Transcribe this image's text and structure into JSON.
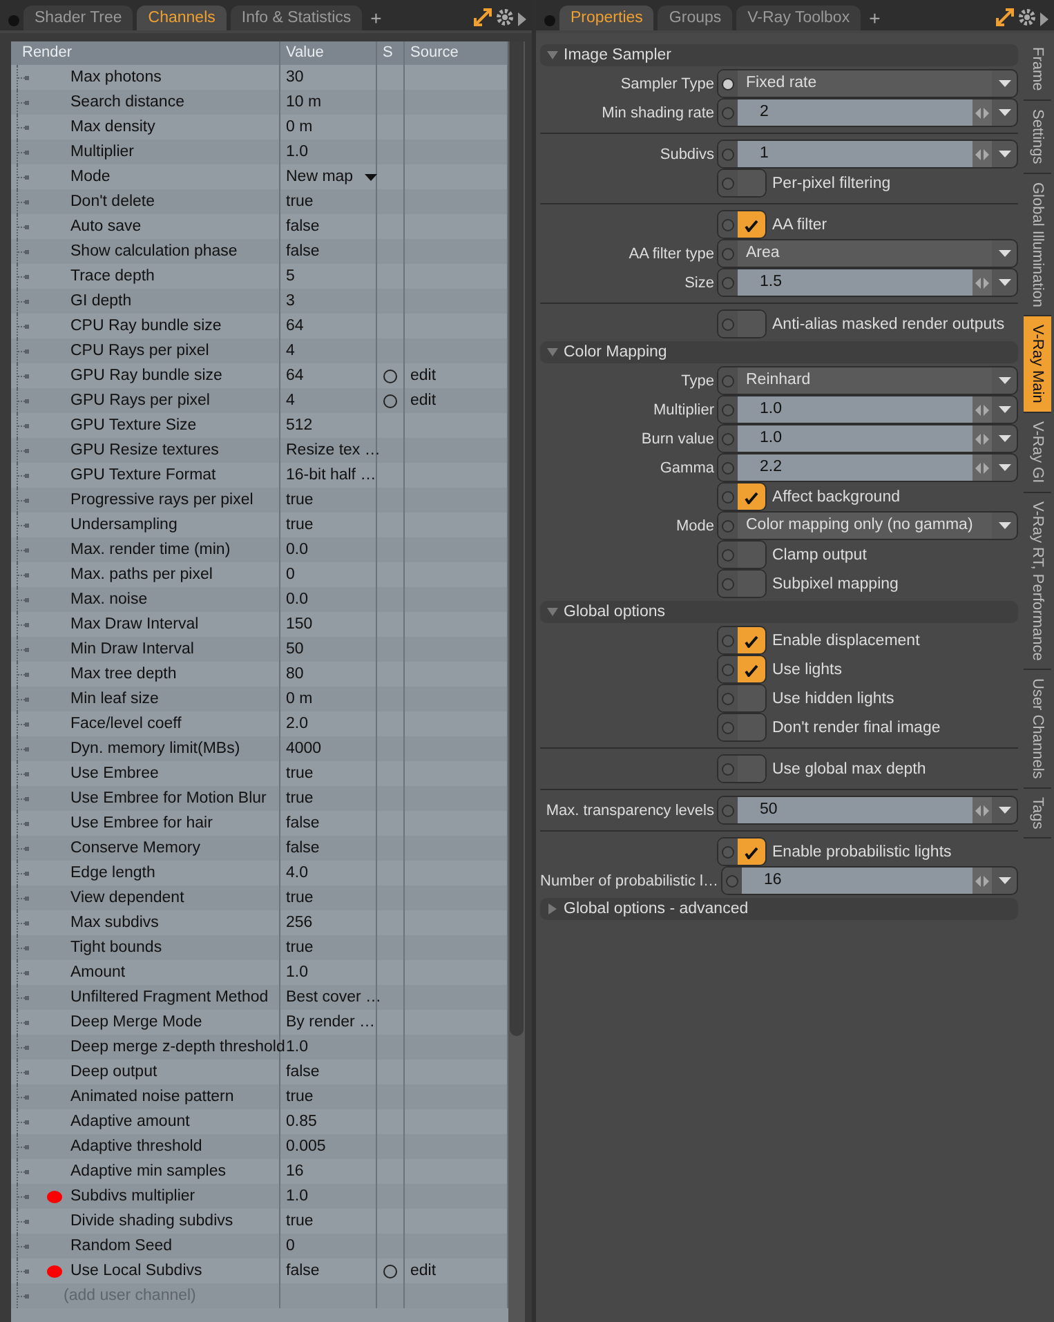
{
  "left_panel": {
    "tabs": [
      {
        "label": "Shader Tree",
        "selected": false
      },
      {
        "label": "Channels",
        "selected": true
      },
      {
        "label": "Info & Statistics",
        "selected": false
      }
    ],
    "add_tab": "+",
    "table": {
      "columns": [
        "Render",
        "Value",
        "S",
        "Source"
      ],
      "rows": [
        {
          "name": "Max photons",
          "value": "30",
          "kind": "text",
          "marked": false
        },
        {
          "name": "Search distance",
          "value": "10 m",
          "kind": "text",
          "marked": false
        },
        {
          "name": "Max density",
          "value": "0 m",
          "kind": "text",
          "marked": false
        },
        {
          "name": "Multiplier",
          "value": "1.0",
          "kind": "text",
          "marked": false
        },
        {
          "name": "Mode",
          "value": "New map",
          "kind": "dropdown",
          "marked": false
        },
        {
          "name": "Don't delete",
          "value": "true",
          "kind": "text",
          "marked": false
        },
        {
          "name": "Auto save",
          "value": "false",
          "kind": "text",
          "marked": false
        },
        {
          "name": "Show calculation phase",
          "value": "false",
          "kind": "text",
          "marked": false
        },
        {
          "name": "Trace depth",
          "value": "5",
          "kind": "text",
          "marked": false
        },
        {
          "name": "GI depth",
          "value": "3",
          "kind": "text",
          "marked": false
        },
        {
          "name": "CPU Ray bundle size",
          "value": "64",
          "kind": "text",
          "marked": false
        },
        {
          "name": "CPU Rays per pixel",
          "value": "4",
          "kind": "text",
          "marked": false
        },
        {
          "name": "GPU Ray bundle size",
          "value": "64",
          "kind": "text",
          "marked": false,
          "source": "edit"
        },
        {
          "name": "GPU Rays per pixel",
          "value": "4",
          "kind": "text",
          "marked": false,
          "source": "edit"
        },
        {
          "name": "GPU Texture Size",
          "value": "512",
          "kind": "text",
          "marked": false
        },
        {
          "name": "GPU Resize textures",
          "value": "Resize tex …",
          "kind": "text",
          "marked": false
        },
        {
          "name": "GPU Texture Format",
          "value": "16-bit half …",
          "kind": "text",
          "marked": false
        },
        {
          "name": "Progressive rays per pixel",
          "value": "true",
          "kind": "text",
          "marked": false
        },
        {
          "name": "Undersampling",
          "value": "true",
          "kind": "text",
          "marked": false
        },
        {
          "name": "Max. render time (min)",
          "value": "0.0",
          "kind": "text",
          "marked": false
        },
        {
          "name": "Max. paths per pixel",
          "value": "0",
          "kind": "text",
          "marked": false
        },
        {
          "name": "Max. noise",
          "value": "0.0",
          "kind": "text",
          "marked": false
        },
        {
          "name": "Max Draw Interval",
          "value": "150",
          "kind": "text",
          "marked": false
        },
        {
          "name": "Min Draw Interval",
          "value": "50",
          "kind": "text",
          "marked": false
        },
        {
          "name": "Max tree depth",
          "value": "80",
          "kind": "text",
          "marked": false
        },
        {
          "name": "Min leaf size",
          "value": "0 m",
          "kind": "text",
          "marked": false
        },
        {
          "name": "Face/level coeff",
          "value": "2.0",
          "kind": "text",
          "marked": false
        },
        {
          "name": "Dyn. memory limit(MBs)",
          "value": "4000",
          "kind": "text",
          "marked": false
        },
        {
          "name": "Use Embree",
          "value": "true",
          "kind": "text",
          "marked": false
        },
        {
          "name": "Use Embree for Motion Blur",
          "value": "true",
          "kind": "text",
          "marked": false
        },
        {
          "name": "Use Embree for hair",
          "value": "false",
          "kind": "text",
          "marked": false
        },
        {
          "name": "Conserve Memory",
          "value": "false",
          "kind": "text",
          "marked": false
        },
        {
          "name": "Edge length",
          "value": "4.0",
          "kind": "text",
          "marked": false
        },
        {
          "name": "View dependent",
          "value": "true",
          "kind": "text",
          "marked": false
        },
        {
          "name": "Max subdivs",
          "value": "256",
          "kind": "text",
          "marked": false
        },
        {
          "name": "Tight bounds",
          "value": "true",
          "kind": "text",
          "marked": false
        },
        {
          "name": "Amount",
          "value": "1.0",
          "kind": "text",
          "marked": false
        },
        {
          "name": "Unfiltered Fragment Method",
          "value": "Best cover …",
          "kind": "text",
          "marked": false
        },
        {
          "name": "Deep Merge Mode",
          "value": "By render  …",
          "kind": "text",
          "marked": false
        },
        {
          "name": "Deep merge z-depth threshold",
          "value": "1.0",
          "kind": "text",
          "marked": false
        },
        {
          "name": "Deep output",
          "value": "false",
          "kind": "text",
          "marked": false
        },
        {
          "name": "Animated noise pattern",
          "value": "true",
          "kind": "text",
          "marked": false
        },
        {
          "name": "Adaptive amount",
          "value": "0.85",
          "kind": "text",
          "marked": false
        },
        {
          "name": "Adaptive threshold",
          "value": "0.005",
          "kind": "text",
          "marked": false
        },
        {
          "name": "Adaptive min samples",
          "value": "16",
          "kind": "text",
          "marked": false
        },
        {
          "name": "Subdivs multiplier",
          "value": "1.0",
          "kind": "text",
          "marked": true
        },
        {
          "name": "Divide shading subdivs",
          "value": "true",
          "kind": "text",
          "marked": false
        },
        {
          "name": "Random Seed",
          "value": "0",
          "kind": "text",
          "marked": false
        },
        {
          "name": "Use Local Subdivs",
          "value": "false",
          "kind": "text",
          "marked": true,
          "source": "edit"
        }
      ],
      "add_channel": "(add user channel)"
    }
  },
  "right_panel": {
    "tabs": [
      {
        "label": "Properties",
        "selected": true
      },
      {
        "label": "Groups",
        "selected": false
      },
      {
        "label": "V-Ray Toolbox",
        "selected": false
      }
    ],
    "add_tab": "+",
    "sections": [
      {
        "title": "Image Sampler",
        "expanded": true,
        "items": [
          {
            "kind": "dropdown",
            "label": "Sampler Type",
            "value": "Fixed rate",
            "keyed": true
          },
          {
            "kind": "number",
            "label": "Min shading rate",
            "value": "2",
            "keyed": false
          },
          {
            "kind": "divider"
          },
          {
            "kind": "number",
            "label": "Subdivs",
            "value": "1",
            "keyed": false
          },
          {
            "kind": "checkbox",
            "label": "Per-pixel filtering",
            "checked": false
          },
          {
            "kind": "divider"
          },
          {
            "kind": "checkbox",
            "label": "AA filter",
            "checked": true
          },
          {
            "kind": "dropdown",
            "label": "AA filter type",
            "value": "Area",
            "keyed": false
          },
          {
            "kind": "number",
            "label": "Size",
            "value": "1.5",
            "keyed": false
          },
          {
            "kind": "divider"
          },
          {
            "kind": "checkbox",
            "label": "Anti-alias masked render outputs",
            "checked": false
          }
        ]
      },
      {
        "title": "Color Mapping",
        "expanded": true,
        "items": [
          {
            "kind": "dropdown",
            "label": "Type",
            "value": "Reinhard",
            "keyed": false
          },
          {
            "kind": "number",
            "label": "Multiplier",
            "value": "1.0",
            "keyed": false
          },
          {
            "kind": "number",
            "label": "Burn value",
            "value": "1.0",
            "keyed": false
          },
          {
            "kind": "number",
            "label": "Gamma",
            "value": "2.2",
            "keyed": false
          },
          {
            "kind": "checkbox",
            "label": "Affect background",
            "checked": true
          },
          {
            "kind": "dropdown",
            "label": "Mode",
            "value": "Color mapping only (no gamma)",
            "keyed": false
          },
          {
            "kind": "checkbox",
            "label": "Clamp output",
            "checked": false
          },
          {
            "kind": "checkbox",
            "label": "Subpixel mapping",
            "checked": false
          }
        ]
      },
      {
        "title": "Global options",
        "expanded": true,
        "items": [
          {
            "kind": "checkbox",
            "label": "Enable displacement",
            "checked": true
          },
          {
            "kind": "checkbox",
            "label": "Use lights",
            "checked": true
          },
          {
            "kind": "checkbox",
            "label": "Use hidden lights",
            "checked": false
          },
          {
            "kind": "checkbox",
            "label": "Don't render final image",
            "checked": false
          },
          {
            "kind": "divider"
          },
          {
            "kind": "checkbox",
            "label": "Use global max depth",
            "checked": false
          },
          {
            "kind": "divider"
          },
          {
            "kind": "number",
            "label": "Max. transparency levels",
            "value": "50",
            "keyed": false
          },
          {
            "kind": "divider"
          },
          {
            "kind": "checkbox",
            "label": "Enable probabilistic lights",
            "checked": true
          },
          {
            "kind": "number",
            "label": "Number of probabilistic l…",
            "value": "16",
            "keyed": false
          }
        ]
      },
      {
        "title": "Global options - advanced",
        "expanded": false
      }
    ],
    "side_tabs": [
      {
        "label": "Frame",
        "selected": false
      },
      {
        "label": "Settings",
        "selected": false
      },
      {
        "label": "Global Illumination",
        "selected": false
      },
      {
        "label": "V-Ray Main",
        "selected": true
      },
      {
        "label": "V-Ray GI",
        "selected": false
      },
      {
        "label": "V-Ray RT, Performance",
        "selected": false
      },
      {
        "label": "User Channels",
        "selected": false
      },
      {
        "label": "Tags",
        "selected": false
      }
    ]
  }
}
